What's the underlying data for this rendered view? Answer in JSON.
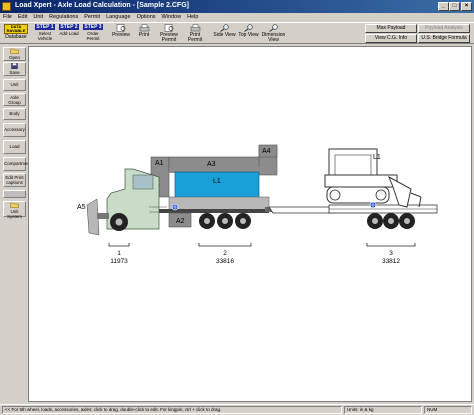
{
  "window": {
    "title": "Load Xpert - Axle Load Calculation - [Sample 2.CFG]"
  },
  "menu": [
    "File",
    "Edit",
    "Unit",
    "Regulations",
    "Permit",
    "Language",
    "Options",
    "Window",
    "Help"
  ],
  "toolbar": {
    "database": {
      "line1": "DATA",
      "line2": "RAVABLE",
      "label": "Database"
    },
    "steps": [
      {
        "head": "STEP 1",
        "label": "Select Vehicle"
      },
      {
        "head": "STEP 2",
        "label": "Add Load"
      },
      {
        "head": "STEP 3",
        "label": "Order Permit"
      }
    ],
    "buttons": [
      "Preview",
      "Print",
      "Preview Permit",
      "Print Permit"
    ],
    "views": [
      "Side View",
      "Top View",
      "Dimension View"
    ],
    "right": {
      "max_payload": "Max Payload",
      "payload_analysis": "Payload Analysis",
      "view_cg_info": "View C.G. Info",
      "us_bridge_formula": "U.S. Bridge Formula"
    }
  },
  "sidebar": [
    "Open",
    "Save",
    "Unit",
    "Axle Group",
    "Body",
    "Accessory",
    "Load",
    "Compartment",
    "Edit Print captions",
    "Unit System"
  ],
  "diagram": {
    "labels": {
      "a1": "A1",
      "a2": "A2",
      "a3": "A3",
      "a4": "A4",
      "a5": "A5",
      "l1_box": "L1",
      "l1_dozer": "L1"
    },
    "axle_groups": [
      {
        "num": "1",
        "load": "11973"
      },
      {
        "num": "2",
        "load": "33816"
      },
      {
        "num": "3",
        "load": "33812"
      }
    ]
  },
  "status": {
    "hint": "<< For 5th wheel, loads, accessories, axles: click to drag, double-click to edit. For kingpin, ctrl + click to drag.",
    "units": "Units: in & kg",
    "mode": "NUM"
  },
  "colors": {
    "title_bar": "#0a246a",
    "step_head": "#1c2a9c",
    "load_box": "#1aa0d8",
    "equipment": "#808080",
    "truck_cab": "#c8dcc8"
  }
}
